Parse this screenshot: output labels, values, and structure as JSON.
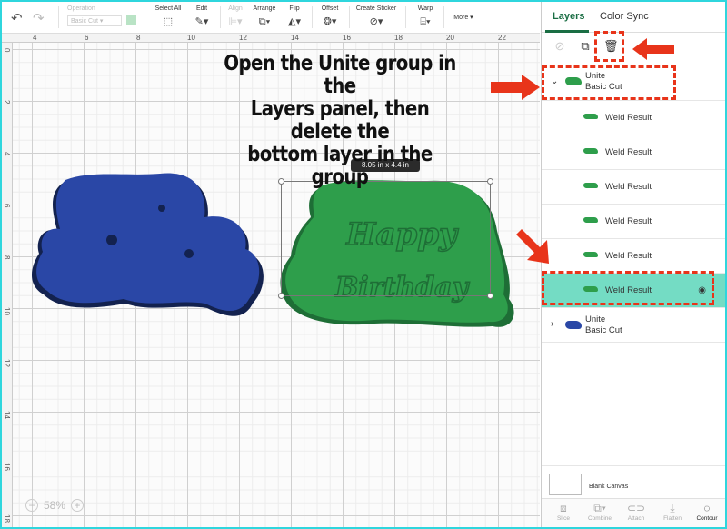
{
  "toolbar": {
    "operation_label": "Operation",
    "operation_value": "Basic Cut",
    "select_all": "Select All",
    "edit": "Edit",
    "align": "Align",
    "arrange": "Arrange",
    "flip": "Flip",
    "offset": "Offset",
    "create_sticker": "Create Sticker",
    "warp": "Warp",
    "more": "More"
  },
  "ruler": {
    "top": [
      "4",
      "6",
      "8",
      "10",
      "12",
      "14",
      "16",
      "18",
      "20",
      "22"
    ],
    "left": [
      "0",
      "2",
      "4",
      "6",
      "8",
      "10",
      "12",
      "14",
      "16",
      "18"
    ]
  },
  "instruction": {
    "line1": "Open the Unite group in the",
    "line2": "Layers panel, then delete the",
    "line3": "bottom layer in the group"
  },
  "canvas": {
    "size_badge": "8.05  in x 4.4  in",
    "zoom": "58%",
    "green_text_1": "Happy",
    "green_text_2": "Birthday",
    "green_color": "#2e9e4b",
    "blue_color": "#2a47a6"
  },
  "panel": {
    "tab_layers": "Layers",
    "tab_color_sync": "Color Sync",
    "group_unite_green": {
      "name": "Unite",
      "sub": "Basic Cut"
    },
    "weld_results": [
      "Weld Result",
      "Weld Result",
      "Weld Result",
      "Weld Result",
      "Weld Result",
      "Weld Result"
    ],
    "group_unite_blue": {
      "name": "Unite",
      "sub": "Basic Cut"
    },
    "blank_canvas": "Blank Canvas",
    "bottom": {
      "slice": "Slice",
      "combine": "Combine",
      "attach": "Attach",
      "flatten": "Flatten",
      "contour": "Contour"
    }
  },
  "colors": {
    "accent": "#1a6e44",
    "selected_row": "#74dcc4",
    "annotation": "#e8341a"
  }
}
